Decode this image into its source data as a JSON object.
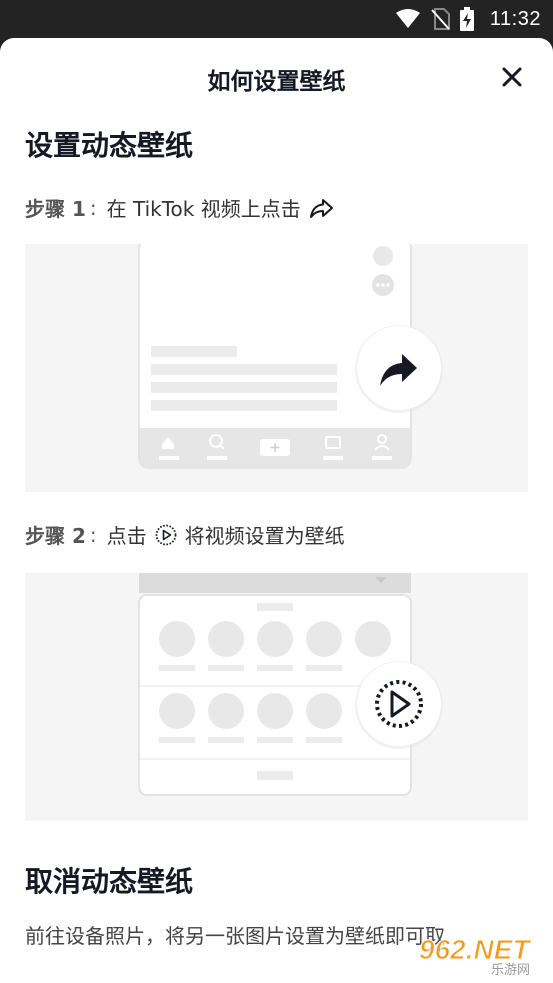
{
  "status_bar": {
    "time": "11:32"
  },
  "header": {
    "title": "如何设置壁纸"
  },
  "section1": {
    "title": "设置动态壁纸",
    "step1": {
      "label": "步骤 1",
      "separator": ":",
      "text": "在 TikTok 视频上点击"
    },
    "step2": {
      "label": "步骤 2",
      "separator": ":",
      "text_before": "点击",
      "text_after": "将视频设置为壁纸"
    }
  },
  "section2": {
    "title": "取消动态壁纸",
    "body": "前往设备照片，将另一张图片设置为壁纸即可取"
  },
  "watermark": {
    "text": "962.NET",
    "subtext": "乐游网"
  },
  "colors": {
    "text_primary": "#161823",
    "illustration_bg": "#f5f5f6",
    "status_bar": "#232323"
  }
}
